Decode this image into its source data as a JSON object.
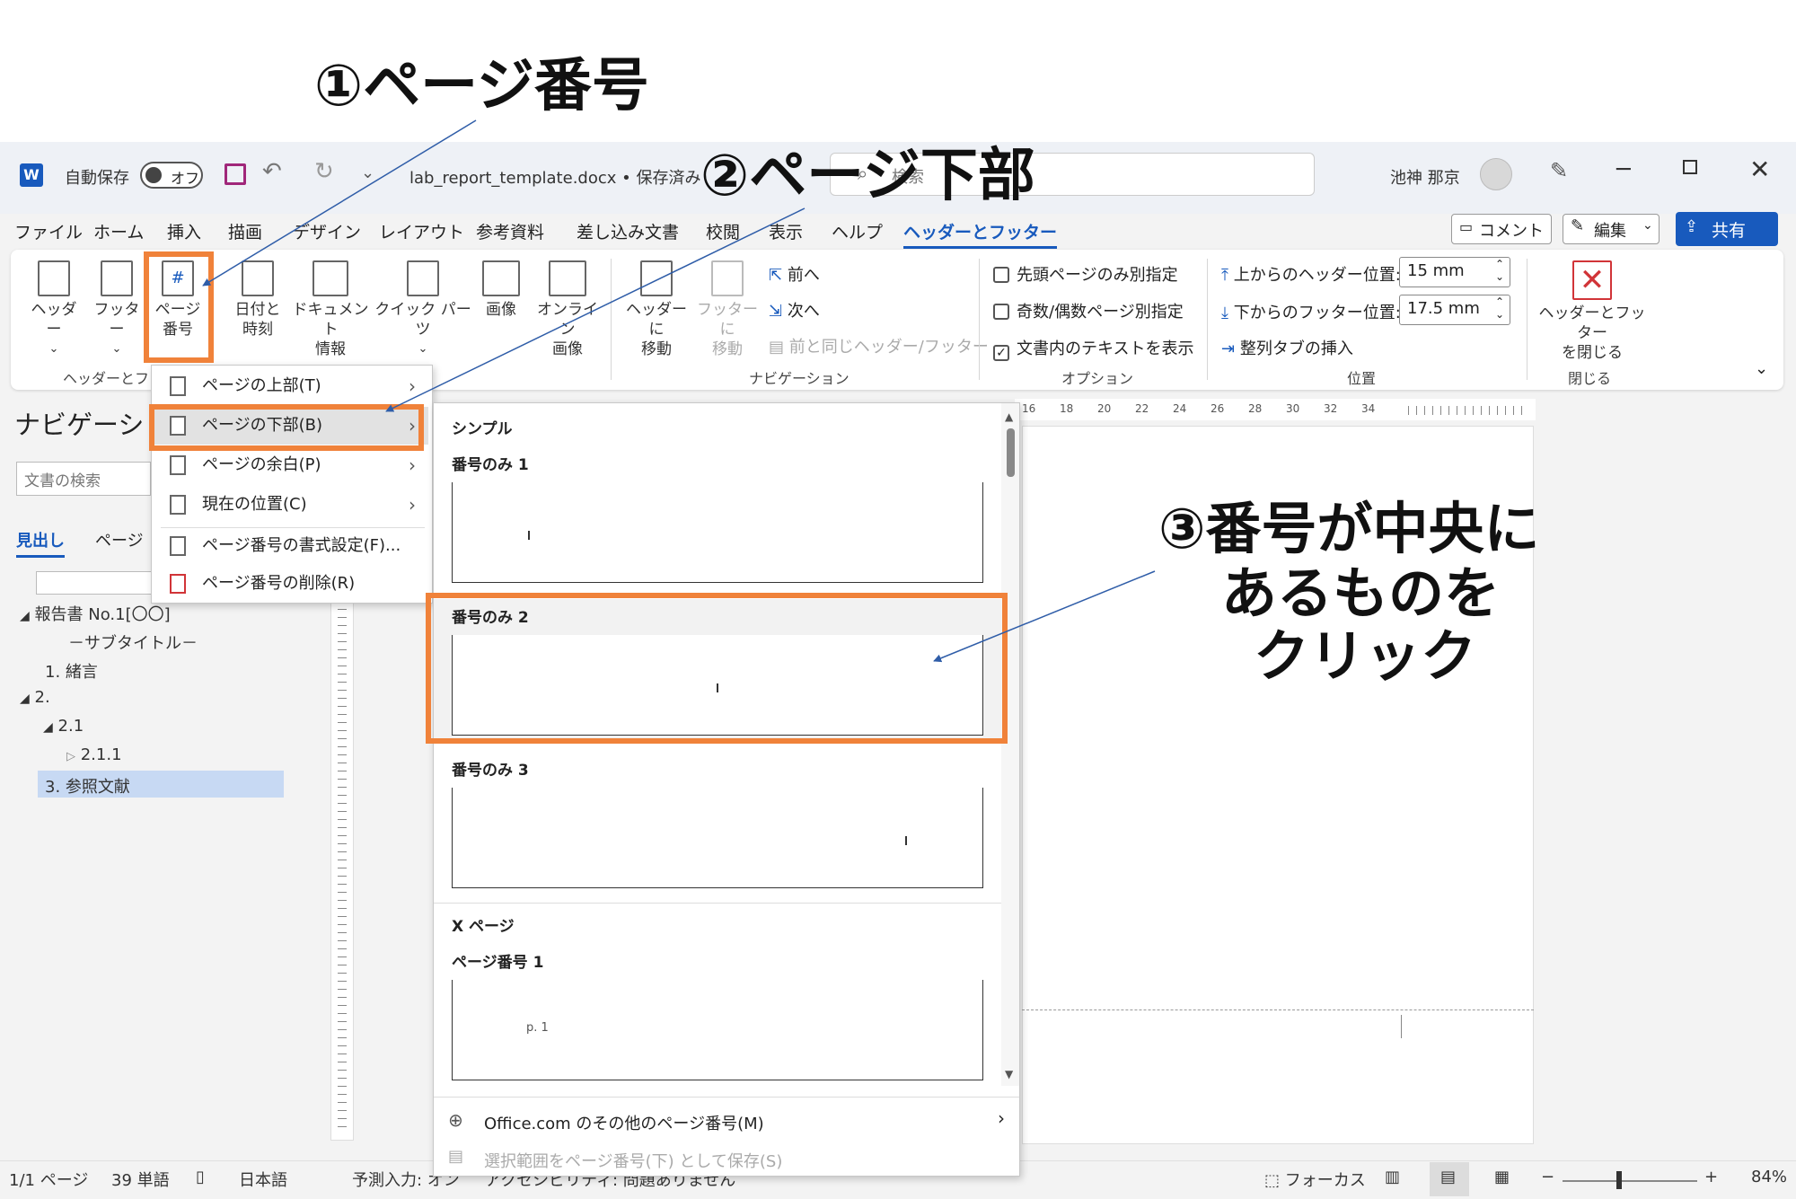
{
  "annotations": {
    "step1": "①ページ番号",
    "step2": "②ページ下部",
    "step3_line1": "③番号が中央に",
    "step3_line2": "あるものを",
    "step3_line3": "クリック"
  },
  "titlebar": {
    "autosave_label": "自動保存",
    "autosave_state": "オフ",
    "doc_title": "lab_report_template.docx • 保存済み",
    "search_placeholder": "検索",
    "user_name": "池神 那京",
    "app_icon": "word-icon"
  },
  "menu_tabs": [
    "ファイル",
    "ホーム",
    "挿入",
    "描画",
    "デザイン",
    "レイアウト",
    "参考資料",
    "差し込み文書",
    "校閲",
    "表示",
    "ヘルプ",
    "ヘッダーとフッター"
  ],
  "right_buttons": {
    "comment": "コメント",
    "edit": "編集",
    "share": "共有"
  },
  "ribbon": {
    "header": "ヘッダー",
    "footer": "フッター",
    "page_number_l1": "ページ",
    "page_number_l2": "番号",
    "datetime_l1": "日付と",
    "datetime_l2": "時刻",
    "docinfo_l1": "ドキュメント",
    "docinfo_l2": "情報",
    "quickparts": "クイック パーツ",
    "picture": "画像",
    "online_l1": "オンライン",
    "online_l2": "画像",
    "goto_header_l1": "ヘッダーに",
    "goto_header_l2": "移動",
    "goto_footer_l1": "フッターに",
    "goto_footer_l2": "移動",
    "prev": "前へ",
    "next": "次へ",
    "link_prev": "前と同じヘッダー/フッター",
    "opt_first": "先頭ページのみ別指定",
    "opt_oddeven": "奇数/偶数ページ別指定",
    "opt_showtext": "文書内のテキストを表示",
    "header_pos_label": "上からのヘッダー位置:",
    "header_pos_value": "15 mm",
    "footer_pos_label": "下からのフッター位置:",
    "footer_pos_value": "17.5 mm",
    "align_tab": "整列タブの挿入",
    "close_l1": "ヘッダーとフッター",
    "close_l2": "を閉じる",
    "group_hf": "ヘッダーとフッ",
    "group_nav": "ナビゲーション",
    "group_opt": "オプション",
    "group_pos": "位置",
    "group_close": "閉じる"
  },
  "nav_pane": {
    "title": "ナビゲーショ",
    "search_placeholder": "文書の検索",
    "tab_headings": "見出し",
    "tab_pages": "ページ",
    "items": [
      "報告書 No.1[〇〇]",
      "－サブタイトル－",
      "1. 緒言",
      "2.",
      "2.1",
      "2.1.1",
      "3. 参照文献"
    ]
  },
  "dropdown_menu": {
    "items": [
      "ページの上部(T)",
      "ページの下部(B)",
      "ページの余白(P)",
      "現在の位置(C)",
      "ページ番号の書式設定(F)...",
      "ページ番号の削除(R)"
    ]
  },
  "gallery": {
    "section1": "シンプル",
    "item1": "番号のみ 1",
    "item2": "番号のみ 2",
    "item3": "番号のみ 3",
    "section2": "X ページ",
    "item4": "ページ番号 1",
    "item4_preview": "p. 1",
    "more": "Office.com のその他のページ番号(M)",
    "save_selection": "選択範囲をページ番号(下) として保存(S)"
  },
  "ruler_ticks": [
    "16",
    "18",
    "20",
    "22",
    "24",
    "26",
    "28",
    "30",
    "32",
    "34"
  ],
  "statusbar": {
    "page": "1/1 ページ",
    "words": "39 単語",
    "language": "日本語",
    "predict": "予測入力: オン",
    "accessibility": "アクセシビリティ: 問題ありません",
    "focus": "フォーカス",
    "zoom": "84%"
  },
  "colors": {
    "accent": "#185abd",
    "callout_border": "#f0823a",
    "selection": "#c7d9f3"
  }
}
